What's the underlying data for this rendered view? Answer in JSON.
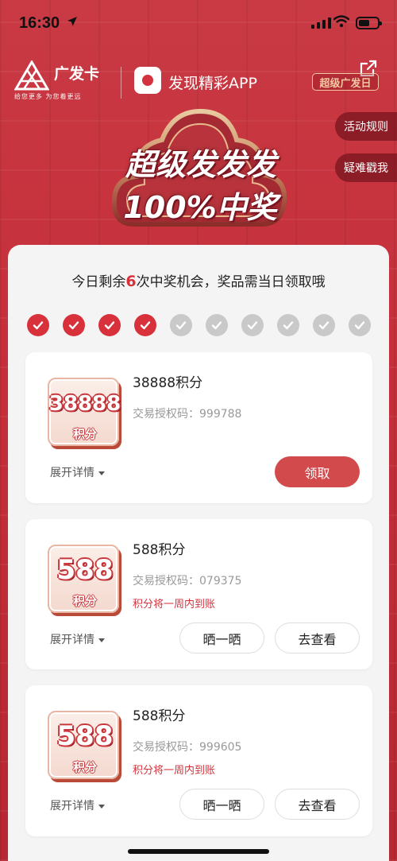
{
  "status_bar": {
    "time": "16:30"
  },
  "header": {
    "brand_name": "广发卡",
    "brand_slogan": "给您更多  为您着更远",
    "app_title": "发现精彩APP",
    "mini_logo": "超级广发日"
  },
  "side_buttons": {
    "rules": "活动规则",
    "help": "疑难戳我"
  },
  "hero": {
    "line1": "超级发发发",
    "line2": "100%中奖"
  },
  "summary": {
    "prefix": "今日剩余",
    "remaining": "6",
    "suffix": "次中奖机会，奖品需当日领取哦"
  },
  "chances": {
    "used": 4,
    "total": 10
  },
  "expand_label": "展开详情",
  "prizes": [
    {
      "tile_amount": "38888",
      "tile_unit": "积分",
      "title": "38888积分",
      "auth": "交易授权码：999788",
      "note": "",
      "button": "领取"
    },
    {
      "tile_amount": "588",
      "tile_unit": "积分",
      "title": "588积分",
      "auth": "交易授权码：079375",
      "note": "积分将一周内到账",
      "share_button": "晒一晒",
      "view_button": "去查看"
    },
    {
      "tile_amount": "588",
      "tile_unit": "积分",
      "title": "588积分",
      "auth": "交易授权码：999605",
      "note": "积分将一周内到账",
      "share_button": "晒一晒",
      "view_button": "去查看"
    }
  ],
  "colors": {
    "primary_red": "#d8313b",
    "background_red": "#c8323d",
    "check_inactive": "#c9c9c9"
  }
}
